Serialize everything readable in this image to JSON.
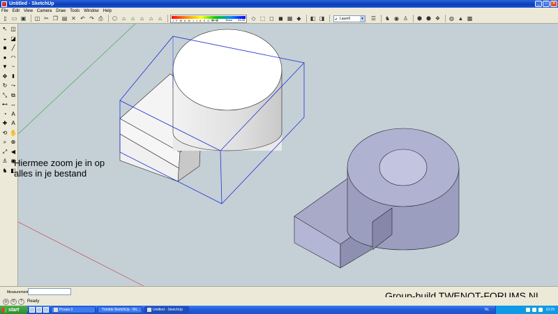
{
  "window": {
    "title": "Untitled - SketchUp",
    "minimize": "_",
    "maximize": "□",
    "close": "✕"
  },
  "menu": [
    "File",
    "Edit",
    "View",
    "Camera",
    "Draw",
    "Tools",
    "Window",
    "Help"
  ],
  "toolbar": {
    "icons": [
      "new-icon",
      "open-icon",
      "save-icon",
      "sep",
      "make-component-icon",
      "cut-icon",
      "copy-icon",
      "paste-icon",
      "erase-icon",
      "undo-icon",
      "redo-icon",
      "print-icon",
      "sep",
      "iso-view-icon",
      "top-view-icon",
      "front-view-icon",
      "right-view-icon",
      "back-view-icon",
      "left-view-icon",
      "sep"
    ],
    "icons2": [
      "xray-icon",
      "wireframe-icon",
      "hidden-line-icon",
      "shaded-icon",
      "textured-icon",
      "monochrome-icon",
      "sep",
      "section-plane-icon",
      "section-cut-icon",
      "sep"
    ],
    "icons3": [
      "layers-icon",
      "sep",
      "walk-icon",
      "look-around-icon",
      "position-camera-icon",
      "sep",
      "get-models-icon",
      "share-model-icon",
      "share-component-icon",
      "sep",
      "google-earth-icon",
      "toggle-terrain-icon",
      "photo-textures-icon"
    ],
    "shadow_months": "J F M A M J J A S O N D",
    "shadow_time_start": "06:43",
    "shadow_time_mid": "Noon",
    "shadow_time_end": "04:46",
    "layer_value": "Layer0"
  },
  "left_tools": [
    {
      "name": "select-icon",
      "glyph": "↖"
    },
    {
      "name": "make-component-tool-icon",
      "glyph": "◫"
    },
    {
      "name": "paint-bucket-icon",
      "glyph": "◒"
    },
    {
      "name": "eraser-icon",
      "glyph": "◪"
    },
    {
      "name": "rectangle-icon",
      "glyph": "■"
    },
    {
      "name": "line-icon",
      "glyph": "╱"
    },
    {
      "name": "circle-icon",
      "glyph": "●"
    },
    {
      "name": "arc-icon",
      "glyph": "◠"
    },
    {
      "name": "polygon-icon",
      "glyph": "▼"
    },
    {
      "name": "freehand-icon",
      "glyph": "~"
    },
    {
      "name": "move-icon",
      "glyph": "✥"
    },
    {
      "name": "push-pull-icon",
      "glyph": "⬍"
    },
    {
      "name": "rotate-icon",
      "glyph": "↻"
    },
    {
      "name": "follow-me-icon",
      "glyph": "⤳"
    },
    {
      "name": "scale-icon",
      "glyph": "⤡"
    },
    {
      "name": "offset-icon",
      "glyph": "⧉"
    },
    {
      "name": "tape-measure-icon",
      "glyph": "⊷"
    },
    {
      "name": "dimension-icon",
      "glyph": "↔"
    },
    {
      "name": "protractor-icon",
      "glyph": "◔"
    },
    {
      "name": "text-icon",
      "glyph": "A"
    },
    {
      "name": "axes-icon",
      "glyph": "✚"
    },
    {
      "name": "3d-text-icon",
      "glyph": "A"
    },
    {
      "name": "orbit-icon",
      "glyph": "⟲"
    },
    {
      "name": "pan-icon",
      "glyph": "✋"
    },
    {
      "name": "zoom-icon",
      "glyph": "⌕"
    },
    {
      "name": "zoom-window-icon",
      "glyph": "⊕"
    },
    {
      "name": "zoom-extents-icon",
      "glyph": "⤢"
    },
    {
      "name": "previous-view-icon",
      "glyph": "◀"
    },
    {
      "name": "position-camera-tool-icon",
      "glyph": "♙"
    },
    {
      "name": "look-around-tool-icon",
      "glyph": "◉"
    },
    {
      "name": "walk-tool-icon",
      "glyph": "♞"
    },
    {
      "name": "section-plane-tool-icon",
      "glyph": "◧"
    }
  ],
  "caption": {
    "line1": "Hiermee zoom je in op",
    "line2": "alles in je bestand"
  },
  "measurements_label": "Measurements",
  "status": {
    "text": "Ready"
  },
  "watermark": "Group-build TWENOT-FORUMS.NL",
  "taskbar": {
    "start": "start",
    "tasks": [
      {
        "label": "Picasa 3",
        "active": false
      },
      {
        "label": "Trimble SketchUp - Wi...",
        "active": false
      },
      {
        "label": "Untitled - SketchUp",
        "active": true
      }
    ],
    "lang": "NL",
    "clock": "10:29"
  }
}
